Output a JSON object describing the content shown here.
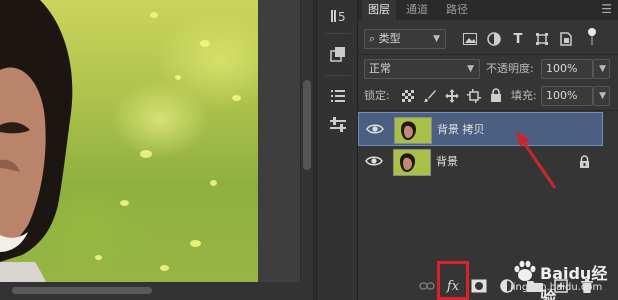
{
  "tabs": [
    {
      "label": "图层",
      "active": true
    },
    {
      "label": "通道",
      "active": false
    },
    {
      "label": "路径",
      "active": false
    }
  ],
  "filter": {
    "label": "类型"
  },
  "blend": {
    "mode": "正常",
    "opacity_label": "不透明度:",
    "opacity_value": "100%"
  },
  "lock": {
    "label": "锁定:",
    "fill_label": "填充:",
    "fill_value": "100%"
  },
  "layers": [
    {
      "name": "背景 拷贝",
      "selected": true,
      "locked": false
    },
    {
      "name": "背景",
      "selected": false,
      "locked": true
    }
  ],
  "footer": {
    "fx_label": "fx"
  },
  "watermark": {
    "brand": "Baidu经验",
    "site": "jingyan.baidu.com"
  },
  "colors": {
    "accent_selected": "#4b5f82",
    "highlight_box": "#d8232a",
    "arrow": "#c8262c"
  }
}
